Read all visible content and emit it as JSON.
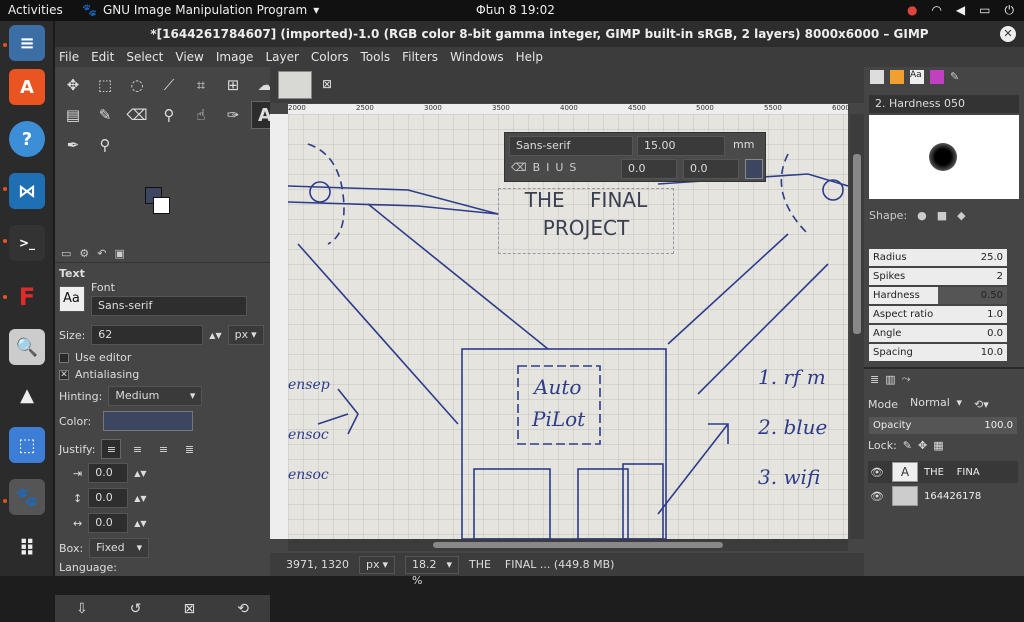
{
  "topbar": {
    "activities": "Activities",
    "app_name": "GNU Image Manipulation Program",
    "clock": "Փետ 8  19:02"
  },
  "window": {
    "title": "*[1644261784607] (imported)-1.0 (RGB color 8-bit gamma integer, GIMP built-in sRGB, 2 layers) 8000x6000 – GIMP"
  },
  "menu": [
    "File",
    "Edit",
    "Select",
    "View",
    "Image",
    "Layer",
    "Colors",
    "Tools",
    "Filters",
    "Windows",
    "Help"
  ],
  "tool_options": {
    "title": "Text",
    "font_label": "Font",
    "font_value": "Sans-serif",
    "size_label": "Size:",
    "size_value": "62",
    "size_unit": "px",
    "use_editor": "Use editor",
    "antialiasing": "Antialiasing",
    "hinting_label": "Hinting:",
    "hinting_value": "Medium",
    "color_label": "Color:",
    "justify_label": "Justify:",
    "indent_value": "0.0",
    "line_spacing_value": "0.0",
    "letter_spacing_value": "0.0",
    "box_label": "Box:",
    "box_value": "Fixed",
    "language_label": "Language:"
  },
  "ruler": [
    "2000",
    "2500",
    "3000",
    "3500",
    "4000",
    "4500",
    "5000",
    "5500",
    "6000"
  ],
  "text_toolbar": {
    "font": "Sans-serif",
    "size": "15.00",
    "unit": "mm",
    "baseline": "0.0",
    "kerning": "0.0"
  },
  "canvas_text": {
    "line1": "THE    FINAL",
    "line2": "PROJECT"
  },
  "status": {
    "coords": "3971, 1320",
    "unit": "px",
    "zoom": "18.2 %",
    "info": "THE    FINAL ... (449.8 MB)"
  },
  "brushes": {
    "selected": "2. Hardness 050",
    "shape_label": "Shape:",
    "params": [
      {
        "label": "Radius",
        "value": "25.0",
        "fraction": 0.0
      },
      {
        "label": "Spikes",
        "value": "2",
        "fraction": 0.0
      },
      {
        "label": "Hardness",
        "value": "0.50",
        "fraction": 0.5
      },
      {
        "label": "Aspect ratio",
        "value": "1.0",
        "fraction": 0.0
      },
      {
        "label": "Angle",
        "value": "0.0",
        "fraction": 0.0
      },
      {
        "label": "Spacing",
        "value": "10.0",
        "fraction": 0.0
      }
    ]
  },
  "layers": {
    "mode_label": "Mode",
    "mode_value": "Normal",
    "opacity_label": "Opacity",
    "opacity_value": "100.0",
    "lock_label": "Lock:",
    "items": [
      {
        "name": "THE    FINA",
        "type": "text"
      },
      {
        "name": "164426178",
        "type": "image"
      }
    ]
  },
  "colors": {
    "foreground": "#3d4660",
    "background": "#ffffff",
    "dock_accent": "#e95420"
  }
}
